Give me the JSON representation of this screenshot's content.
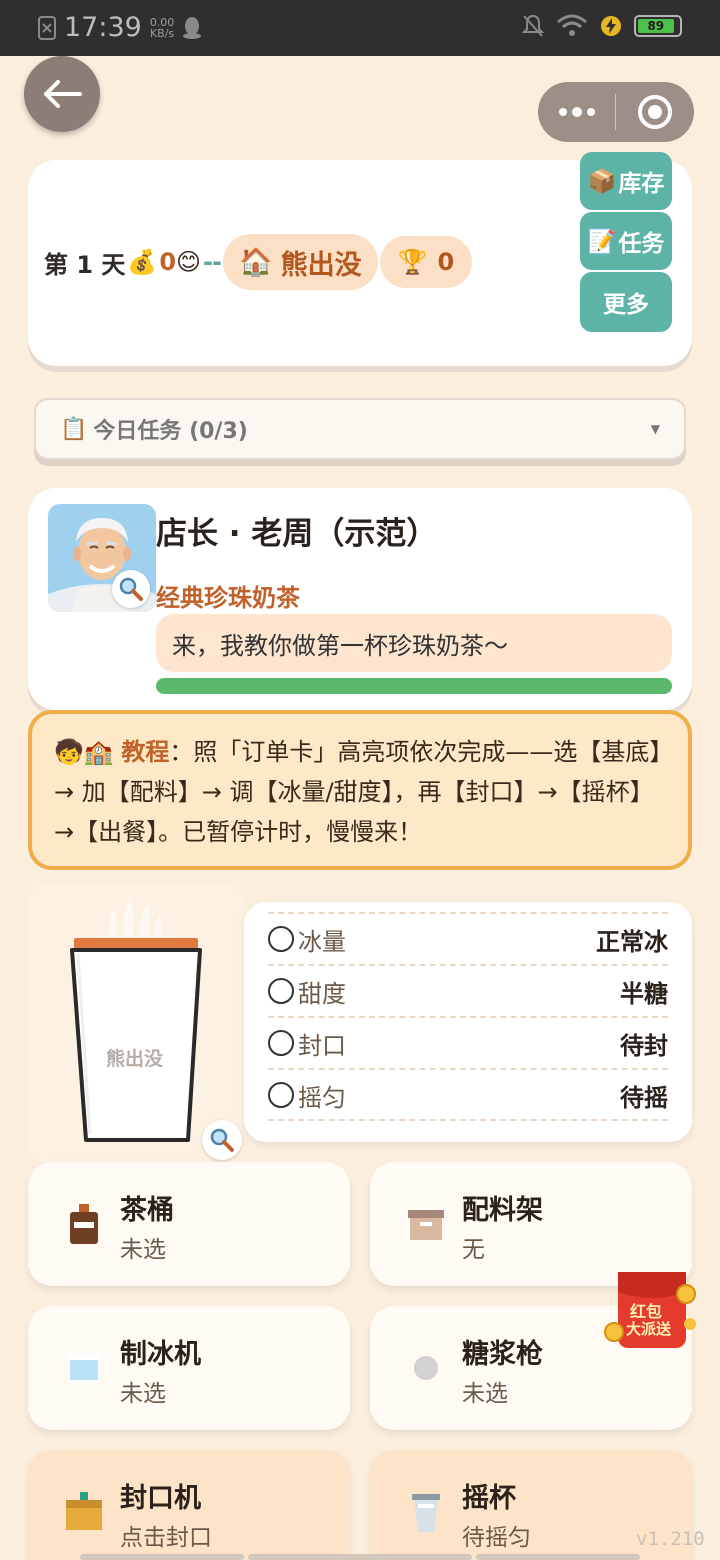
{
  "status_bar": {
    "time": "17:39",
    "speed_value": "0.00",
    "speed_unit": "KB/s",
    "battery": "89"
  },
  "capsule": {
    "more_icon": "more-dots-icon",
    "target_icon": "target-icon"
  },
  "header": {
    "day_label": "第 1 天",
    "coin_icon": "💰",
    "money": "0",
    "mood_icon": "😊",
    "dash": "--",
    "shop_icon": "🏠",
    "shop_name": "熊出没",
    "trophy_icon": "🏆",
    "trophy_count": "0",
    "buttons": [
      {
        "icon": "📦",
        "label": "库存"
      },
      {
        "icon": "📝",
        "label": "任务"
      },
      {
        "icon": "",
        "label": "更多"
      }
    ]
  },
  "tasks_dropdown": {
    "icon": "📋",
    "label": "今日任务 (0/3)",
    "caret": "▼"
  },
  "customer": {
    "name": "店长 · 老周（示范）",
    "drink": "经典珍珠奶茶",
    "speech": "来，我教你做第一杯珍珠奶茶～",
    "patience": 1.0
  },
  "tutorial": {
    "icons": "🧒🏫",
    "label": "教程",
    "text": "：照「订单卡」高亮项依次完成——选【基底】→ 加【配料】→ 调【冰量/甜度】，再【封口】→【摇杯】→【出餐】。已暂停计时，慢慢来！"
  },
  "cup": {
    "brand": "熊出没"
  },
  "order_status": [
    {
      "label": "冰量",
      "value": "正常冰"
    },
    {
      "label": "甜度",
      "value": "半糖"
    },
    {
      "label": "封口",
      "value": "待封"
    },
    {
      "label": "摇匀",
      "value": "待摇"
    }
  ],
  "stations": [
    {
      "title": "茶桶",
      "sub": "未选",
      "icon": "tea-bucket-icon"
    },
    {
      "title": "配料架",
      "sub": "无",
      "icon": "topping-rack-icon"
    },
    {
      "title": "制冰机",
      "sub": "未选",
      "icon": "ice-machine-icon"
    },
    {
      "title": "糖浆枪",
      "sub": "未选",
      "icon": "syrup-gun-icon"
    },
    {
      "title": "封口机",
      "sub": "点击封口",
      "icon": "sealer-icon"
    },
    {
      "title": "摇杯",
      "sub": "待摇匀",
      "icon": "shaker-icon"
    }
  ],
  "red_packet": {
    "line1": "红包",
    "line2": "大派送"
  },
  "version": "v1.210"
}
